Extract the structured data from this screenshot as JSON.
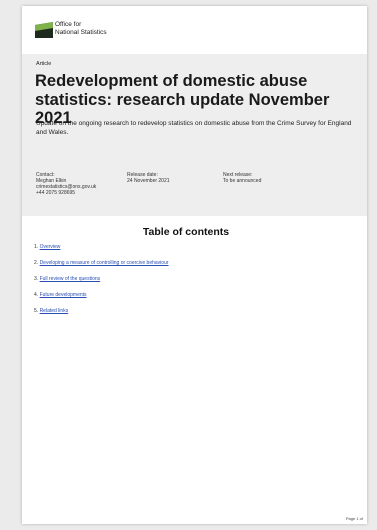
{
  "header": {
    "logo_line1": "Office for",
    "logo_line2": "National Statistics"
  },
  "article": {
    "label": "Article",
    "title": "Redevelopment of domestic abuse statistics: research update November 2021",
    "summary": "Update on the ongoing research to redevelop statistics on domestic abuse from the Crime Survey for England and Wales."
  },
  "meta": {
    "contact_label": "Contact:",
    "contact_name": "Meghan Elkin",
    "contact_email": "crimestatistics@ons.gov.uk",
    "contact_phone": "+44 2075 928695",
    "release_label": "Release date:",
    "release_value": "24 November 2021",
    "next_label": "Next release:",
    "next_value": "To be announced"
  },
  "toc": {
    "heading": "Table of contents",
    "items": [
      {
        "num": "1.",
        "label": "Overview"
      },
      {
        "num": "2.",
        "label": "Developing a measure of controlling or coercive behaviour"
      },
      {
        "num": "3.",
        "label": "Full review of the questions"
      },
      {
        "num": "4.",
        "label": "Future developments"
      },
      {
        "num": "5.",
        "label": "Related links"
      }
    ]
  },
  "footer": {
    "page_number": "Page 1 of"
  },
  "colors": {
    "link": "#2a4fb3",
    "banner": "#eeeeee",
    "logo_dark": "#1f2a1f",
    "logo_green": "#7fb24a"
  }
}
